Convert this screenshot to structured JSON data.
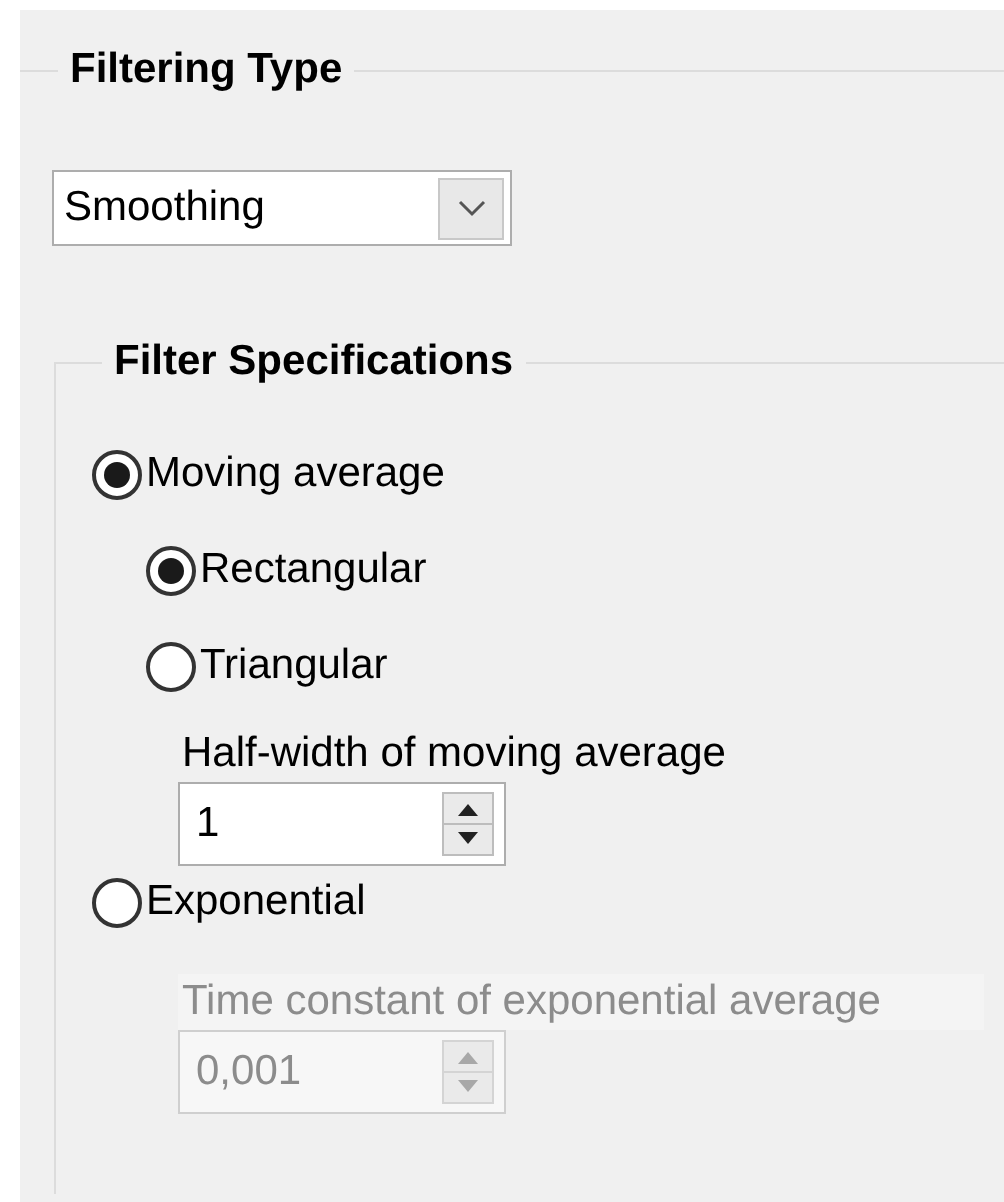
{
  "filtering_type": {
    "title": "Filtering Type",
    "dropdown": {
      "value": "Smoothing"
    }
  },
  "filter_specifications": {
    "title": "Filter Specifications",
    "methods": [
      {
        "label": "Moving average",
        "selected": true,
        "shapes": [
          {
            "label": "Rectangular",
            "selected": true
          },
          {
            "label": "Triangular",
            "selected": false
          }
        ],
        "field": {
          "label": "Half-width of moving average",
          "value": "1",
          "disabled": false
        }
      },
      {
        "label": "Exponential",
        "selected": false,
        "field": {
          "label": "Time constant of exponential average",
          "value": "0,001",
          "disabled": true
        }
      }
    ]
  }
}
